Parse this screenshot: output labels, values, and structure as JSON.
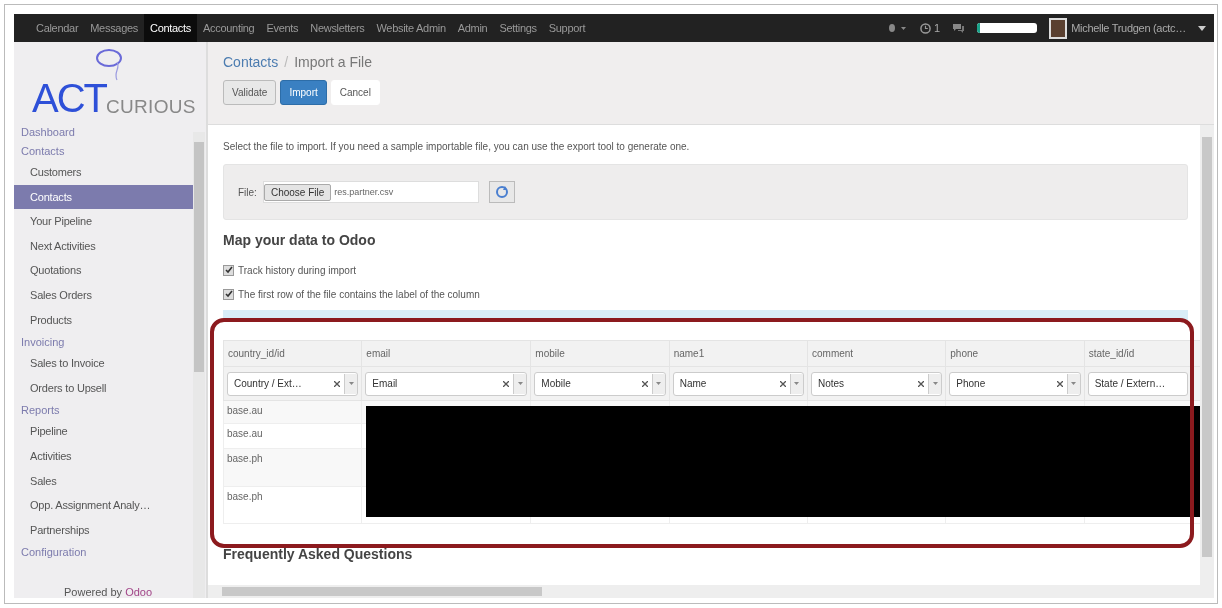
{
  "top_menu": [
    {
      "label": "Calendar",
      "selected": false
    },
    {
      "label": "Messages",
      "selected": false
    },
    {
      "label": "Contacts",
      "selected": true
    },
    {
      "label": "Accounting",
      "selected": false
    },
    {
      "label": "Events",
      "selected": false
    },
    {
      "label": "Newsletters",
      "selected": false
    },
    {
      "label": "Website Admin",
      "selected": false
    },
    {
      "label": "Admin",
      "selected": false
    },
    {
      "label": "Settings",
      "selected": false
    },
    {
      "label": "Support",
      "selected": false
    }
  ],
  "systray": {
    "activity_count": "1",
    "progress": {
      "level": 0.05
    },
    "user_name": "Michelle Trudgen (actc…"
  },
  "logo": {
    "main": "ACT",
    "sub": "CURIOUS"
  },
  "sidebar": {
    "sections": [
      {
        "title": "Dashboard"
      },
      {
        "title": "Contacts",
        "items": [
          {
            "label": "Customers",
            "selected": false
          },
          {
            "label": "Contacts",
            "selected": true
          },
          {
            "label": "Your Pipeline",
            "selected": false
          },
          {
            "label": "Next Activities",
            "selected": false
          },
          {
            "label": "Quotations",
            "selected": false
          },
          {
            "label": "Sales Orders",
            "selected": false
          },
          {
            "label": "Products",
            "selected": false
          }
        ]
      },
      {
        "title": "Invoicing",
        "items": [
          {
            "label": "Sales to Invoice",
            "selected": false
          },
          {
            "label": "Orders to Upsell",
            "selected": false
          }
        ]
      },
      {
        "title": "Reports",
        "items": [
          {
            "label": "Pipeline",
            "selected": false
          },
          {
            "label": "Activities",
            "selected": false
          },
          {
            "label": "Sales",
            "selected": false
          },
          {
            "label": "Opp. Assignment Analy…",
            "selected": false
          },
          {
            "label": "Partnerships",
            "selected": false
          }
        ]
      },
      {
        "title": "Configuration"
      }
    ],
    "footer": {
      "prefix": "Powered by",
      "brand": "Odoo"
    }
  },
  "breadcrumb": {
    "parent": "Contacts",
    "separator": "/",
    "current": "Import a File"
  },
  "buttons": [
    {
      "label": "Validate",
      "kind": "default"
    },
    {
      "label": "Import",
      "kind": "primary"
    },
    {
      "label": "Cancel",
      "kind": "link"
    }
  ],
  "intro": "Select the file to import. If you need a sample importable file, you can use the export tool to generate one.",
  "file": {
    "label": "File:",
    "button": "Choose File",
    "value": "res.partner.csv"
  },
  "map_heading": "Map your data to Odoo",
  "options": [
    {
      "label": "Track history during import",
      "checked": true
    },
    {
      "label": "The first row of the file contains the label of the column",
      "checked": true
    }
  ],
  "table": {
    "columns": [
      {
        "header": "country_id/id",
        "field": "Country / Ext…",
        "kind": "select"
      },
      {
        "header": "email",
        "field": "Email",
        "kind": "select"
      },
      {
        "header": "mobile",
        "field": "Mobile",
        "kind": "select"
      },
      {
        "header": "name1",
        "field": "Name",
        "kind": "select"
      },
      {
        "header": "comment",
        "field": "Notes",
        "kind": "select"
      },
      {
        "header": "phone",
        "field": "Phone",
        "kind": "select"
      },
      {
        "header": "state_id/id",
        "field": "State / Extern…",
        "kind": "cut"
      }
    ],
    "rows": [
      "base.au",
      "base.au",
      "base.ph",
      "base.ph"
    ]
  },
  "faq_heading": "Frequently Asked Questions"
}
